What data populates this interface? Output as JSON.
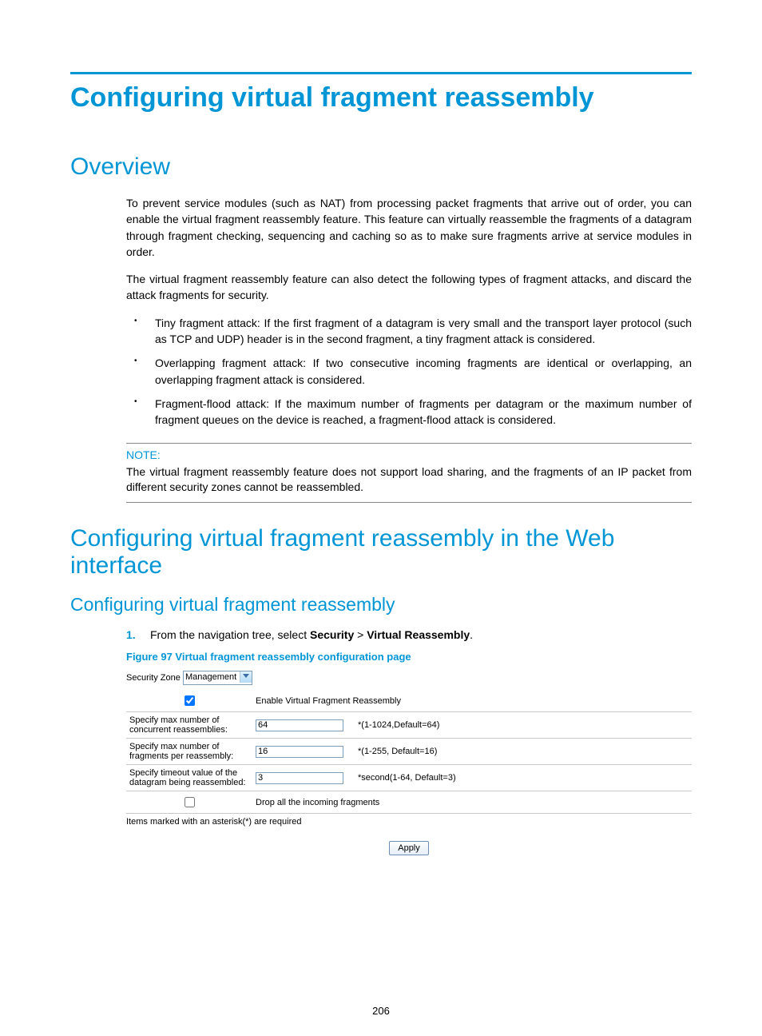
{
  "title": "Configuring virtual fragment reassembly",
  "section_overview": "Overview",
  "overview_p1": "To prevent service modules (such as NAT) from processing packet fragments that arrive out of order, you can enable the virtual fragment reassembly feature. This feature can virtually reassemble the fragments of a datagram through fragment checking, sequencing and caching so as to make sure fragments arrive at service modules in order.",
  "overview_p2": "The virtual fragment reassembly feature can also detect the following types of fragment attacks, and discard the attack fragments for security.",
  "bullets": [
    "Tiny fragment attack: If the first fragment of a datagram is very small and the transport layer protocol (such as TCP and UDP) header is in the second fragment, a tiny fragment attack is considered.",
    "Overlapping fragment attack: If two consecutive incoming fragments are identical or overlapping, an overlapping fragment attack is considered.",
    "Fragment-flood attack: If the maximum number of fragments per datagram or the maximum number of fragment queues on the device is reached, a fragment-flood attack is considered."
  ],
  "note_label": "NOTE:",
  "note_text": "The virtual fragment reassembly feature does not support load sharing, and the fragments of an IP packet from different security zones cannot be reassembled.",
  "section_web": "Configuring virtual fragment reassembly in the Web interface",
  "subsection_cfg": "Configuring virtual fragment reassembly",
  "step1_pre": "From the navigation tree, select ",
  "step1_bold1": "Security",
  "step1_mid": " > ",
  "step1_bold2": "Virtual Reassembly",
  "step1_post": ".",
  "fig_caption": "Figure 97 Virtual fragment reassembly configuration page",
  "form": {
    "sec_zone_label": "Security Zone",
    "sec_zone_value": "Management",
    "enable_label": "Enable Virtual Fragment Reassembly",
    "row1_label": "Specify max number of concurrent reassemblies:",
    "row1_value": "64",
    "row1_hint": "*(1-1024,Default=64)",
    "row2_label": "Specify max number of fragments per reassembly:",
    "row2_value": "16",
    "row2_hint": "*(1-255, Default=16)",
    "row3_label": "Specify timeout value of the datagram being reassembled:",
    "row3_value": "3",
    "row3_hint": "*second(1-64, Default=3)",
    "drop_label": "Drop all the incoming fragments",
    "footer": "Items marked with an asterisk(*) are required",
    "apply": "Apply"
  },
  "page_num": "206"
}
